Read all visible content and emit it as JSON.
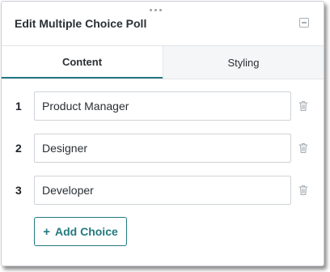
{
  "panel": {
    "title": "Edit Multiple Choice Poll",
    "drag_handle_icon": "drag-dots-icon",
    "collapse_icon": "minus-square-icon"
  },
  "tabs": [
    {
      "label": "Content",
      "active": true
    },
    {
      "label": "Styling",
      "active": false
    }
  ],
  "choices": [
    {
      "number": "1",
      "value": "Product Manager"
    },
    {
      "number": "2",
      "value": "Designer"
    },
    {
      "number": "3",
      "value": "Developer"
    }
  ],
  "add_choice": {
    "icon": "+",
    "label": "Add Choice"
  },
  "colors": {
    "accent": "#23797f",
    "icon_gray": "#a7adb3",
    "inactive_tab_bg": "#f5f6f7"
  }
}
